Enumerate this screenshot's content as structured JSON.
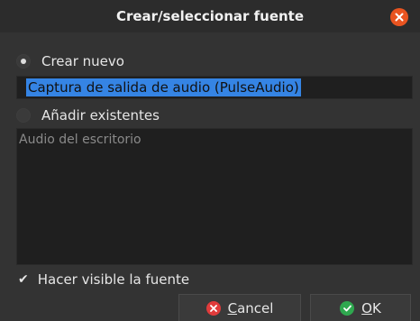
{
  "window": {
    "title": "Crear/seleccionar fuente",
    "close_icon": "close-icon"
  },
  "options": {
    "create_new": {
      "label": "Crear nuevo",
      "selected": true
    },
    "new_name": {
      "value": "Captura de salida de audio (PulseAudio)"
    },
    "add_existing": {
      "label": "Añadir existentes",
      "selected": false
    },
    "existing_sources": [
      "Audio del escritorio"
    ],
    "make_visible": {
      "label": "Hacer visible la fuente",
      "checked": true
    }
  },
  "buttons": {
    "cancel": {
      "label": "Cancel",
      "mnemonic": "C",
      "rest": "ancel",
      "icon": "cancel-icon",
      "color": "#e03b3b"
    },
    "ok": {
      "label": "OK",
      "mnemonic": "O",
      "rest": "K",
      "icon": "check-icon",
      "color": "#2fa84f"
    }
  },
  "colors": {
    "accent": "#e95420",
    "selection": "#3584e4",
    "background": "#333333"
  }
}
